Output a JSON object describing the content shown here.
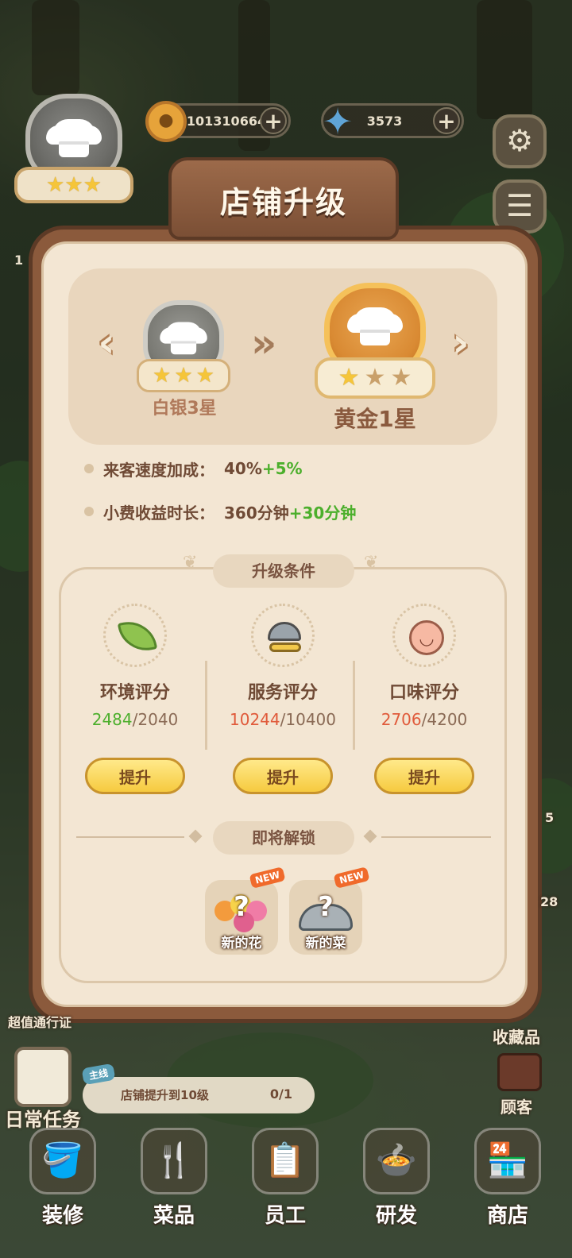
{
  "hud": {
    "coins": "101310664",
    "gems": "3573",
    "plus": "+",
    "coin_icon": "coin-paw-icon",
    "gem_icon": "blue-gem-icon",
    "settings_icon": "gear-icon",
    "menu_icon": "list-icon",
    "current_rank_stars": "★★★",
    "side_left_label": "超值通行证",
    "side_left_num": "1",
    "side_right_num1": "5",
    "side_right_num2": "28"
  },
  "dialog": {
    "title": "店铺升级",
    "from_rank": "白银3星",
    "to_rank": "黄金1星",
    "from_stars": [
      "★",
      "★",
      "★"
    ],
    "to_stars_filled": "★",
    "to_stars_empty": [
      "★",
      "★"
    ],
    "stats": [
      {
        "label": "来客速度加成：",
        "value": "40%",
        "gain": " +5%"
      },
      {
        "label": "小费收益时长：",
        "value": "360分钟",
        "gain": "+30分钟"
      }
    ],
    "requirements_title": "升级条件",
    "requirements": [
      {
        "name": "环境评分",
        "current": "2484",
        "target": "/2040",
        "button": "提升",
        "met": true
      },
      {
        "name": "服务评分",
        "current": "10244",
        "target": "/10400",
        "button": "提升",
        "met": false
      },
      {
        "name": "口味评分",
        "current": "2706",
        "target": "/4200",
        "button": "提升",
        "met": false
      }
    ],
    "unlock_title": "即将解锁",
    "unlocks": [
      {
        "label": "新的花",
        "badge": "NEW",
        "mark": "?"
      },
      {
        "label": "新的菜",
        "badge": "NEW",
        "mark": "?"
      }
    ]
  },
  "bottom": {
    "collection": "收藏品",
    "customers": "顾客",
    "daily_tasks": "日常任务",
    "quest_tag": "主线",
    "quest_text": "店铺提升到10级",
    "quest_progress": "0/1",
    "tabs": [
      {
        "label": "装修",
        "icon": "paint-bucket-icon",
        "glyph": "🪣"
      },
      {
        "label": "菜品",
        "icon": "utensils-icon",
        "glyph": "🍴"
      },
      {
        "label": "员工",
        "icon": "staff-clipboard-icon",
        "glyph": "📋"
      },
      {
        "label": "研发",
        "icon": "cooking-pot-icon",
        "glyph": "🍲"
      },
      {
        "label": "商店",
        "icon": "shop-icon",
        "glyph": "🏪"
      }
    ]
  }
}
